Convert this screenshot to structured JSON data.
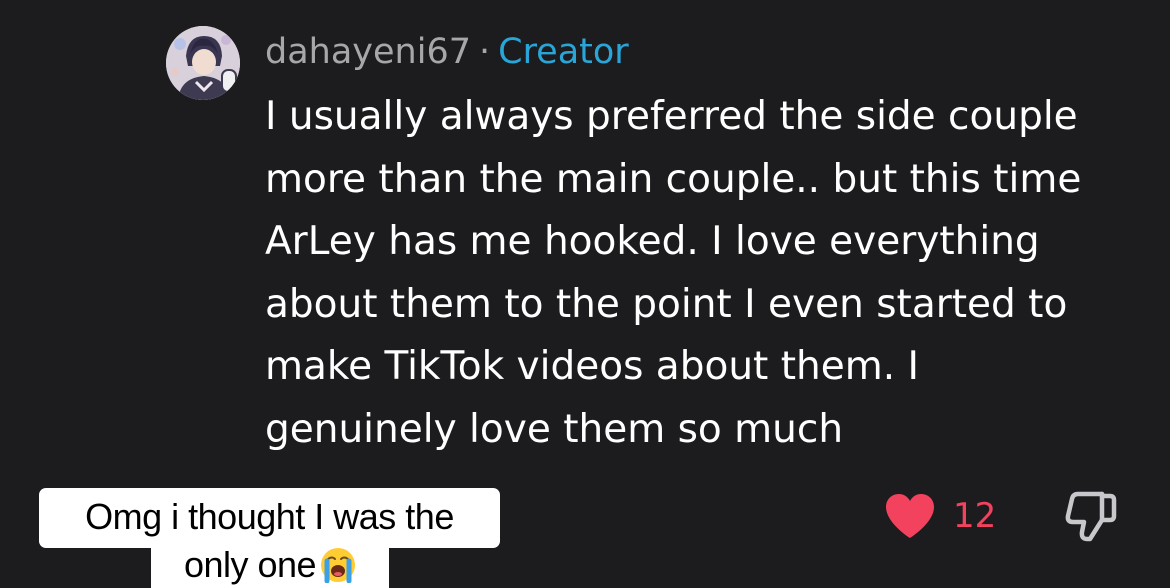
{
  "comment": {
    "username": "dahayeni67",
    "separator": "·",
    "badge": "Creator",
    "text_lines": [
      "I usually always preferred the side couple",
      "more than the main couple.. but this time",
      "ArLey has me hooked. I love everything",
      "about them to the point I even started to",
      "make TikTok videos about them. I",
      "genuinely love them so much"
    ],
    "likes": "12",
    "avatar_icon": "user-avatar-illustration",
    "like_icon": "heart-icon",
    "dislike_icon": "thumbs-down-icon"
  },
  "caption": {
    "line1": "Omg i thought I was the",
    "line2": "only one",
    "emoji_icon": "loudly-crying-face-emoji"
  },
  "colors": {
    "background": "#1c1c1e",
    "username": "#a7a7aa",
    "creator_badge": "#2aa5d8",
    "like_red": "#f2425e",
    "caption_bg": "#ffffff"
  }
}
